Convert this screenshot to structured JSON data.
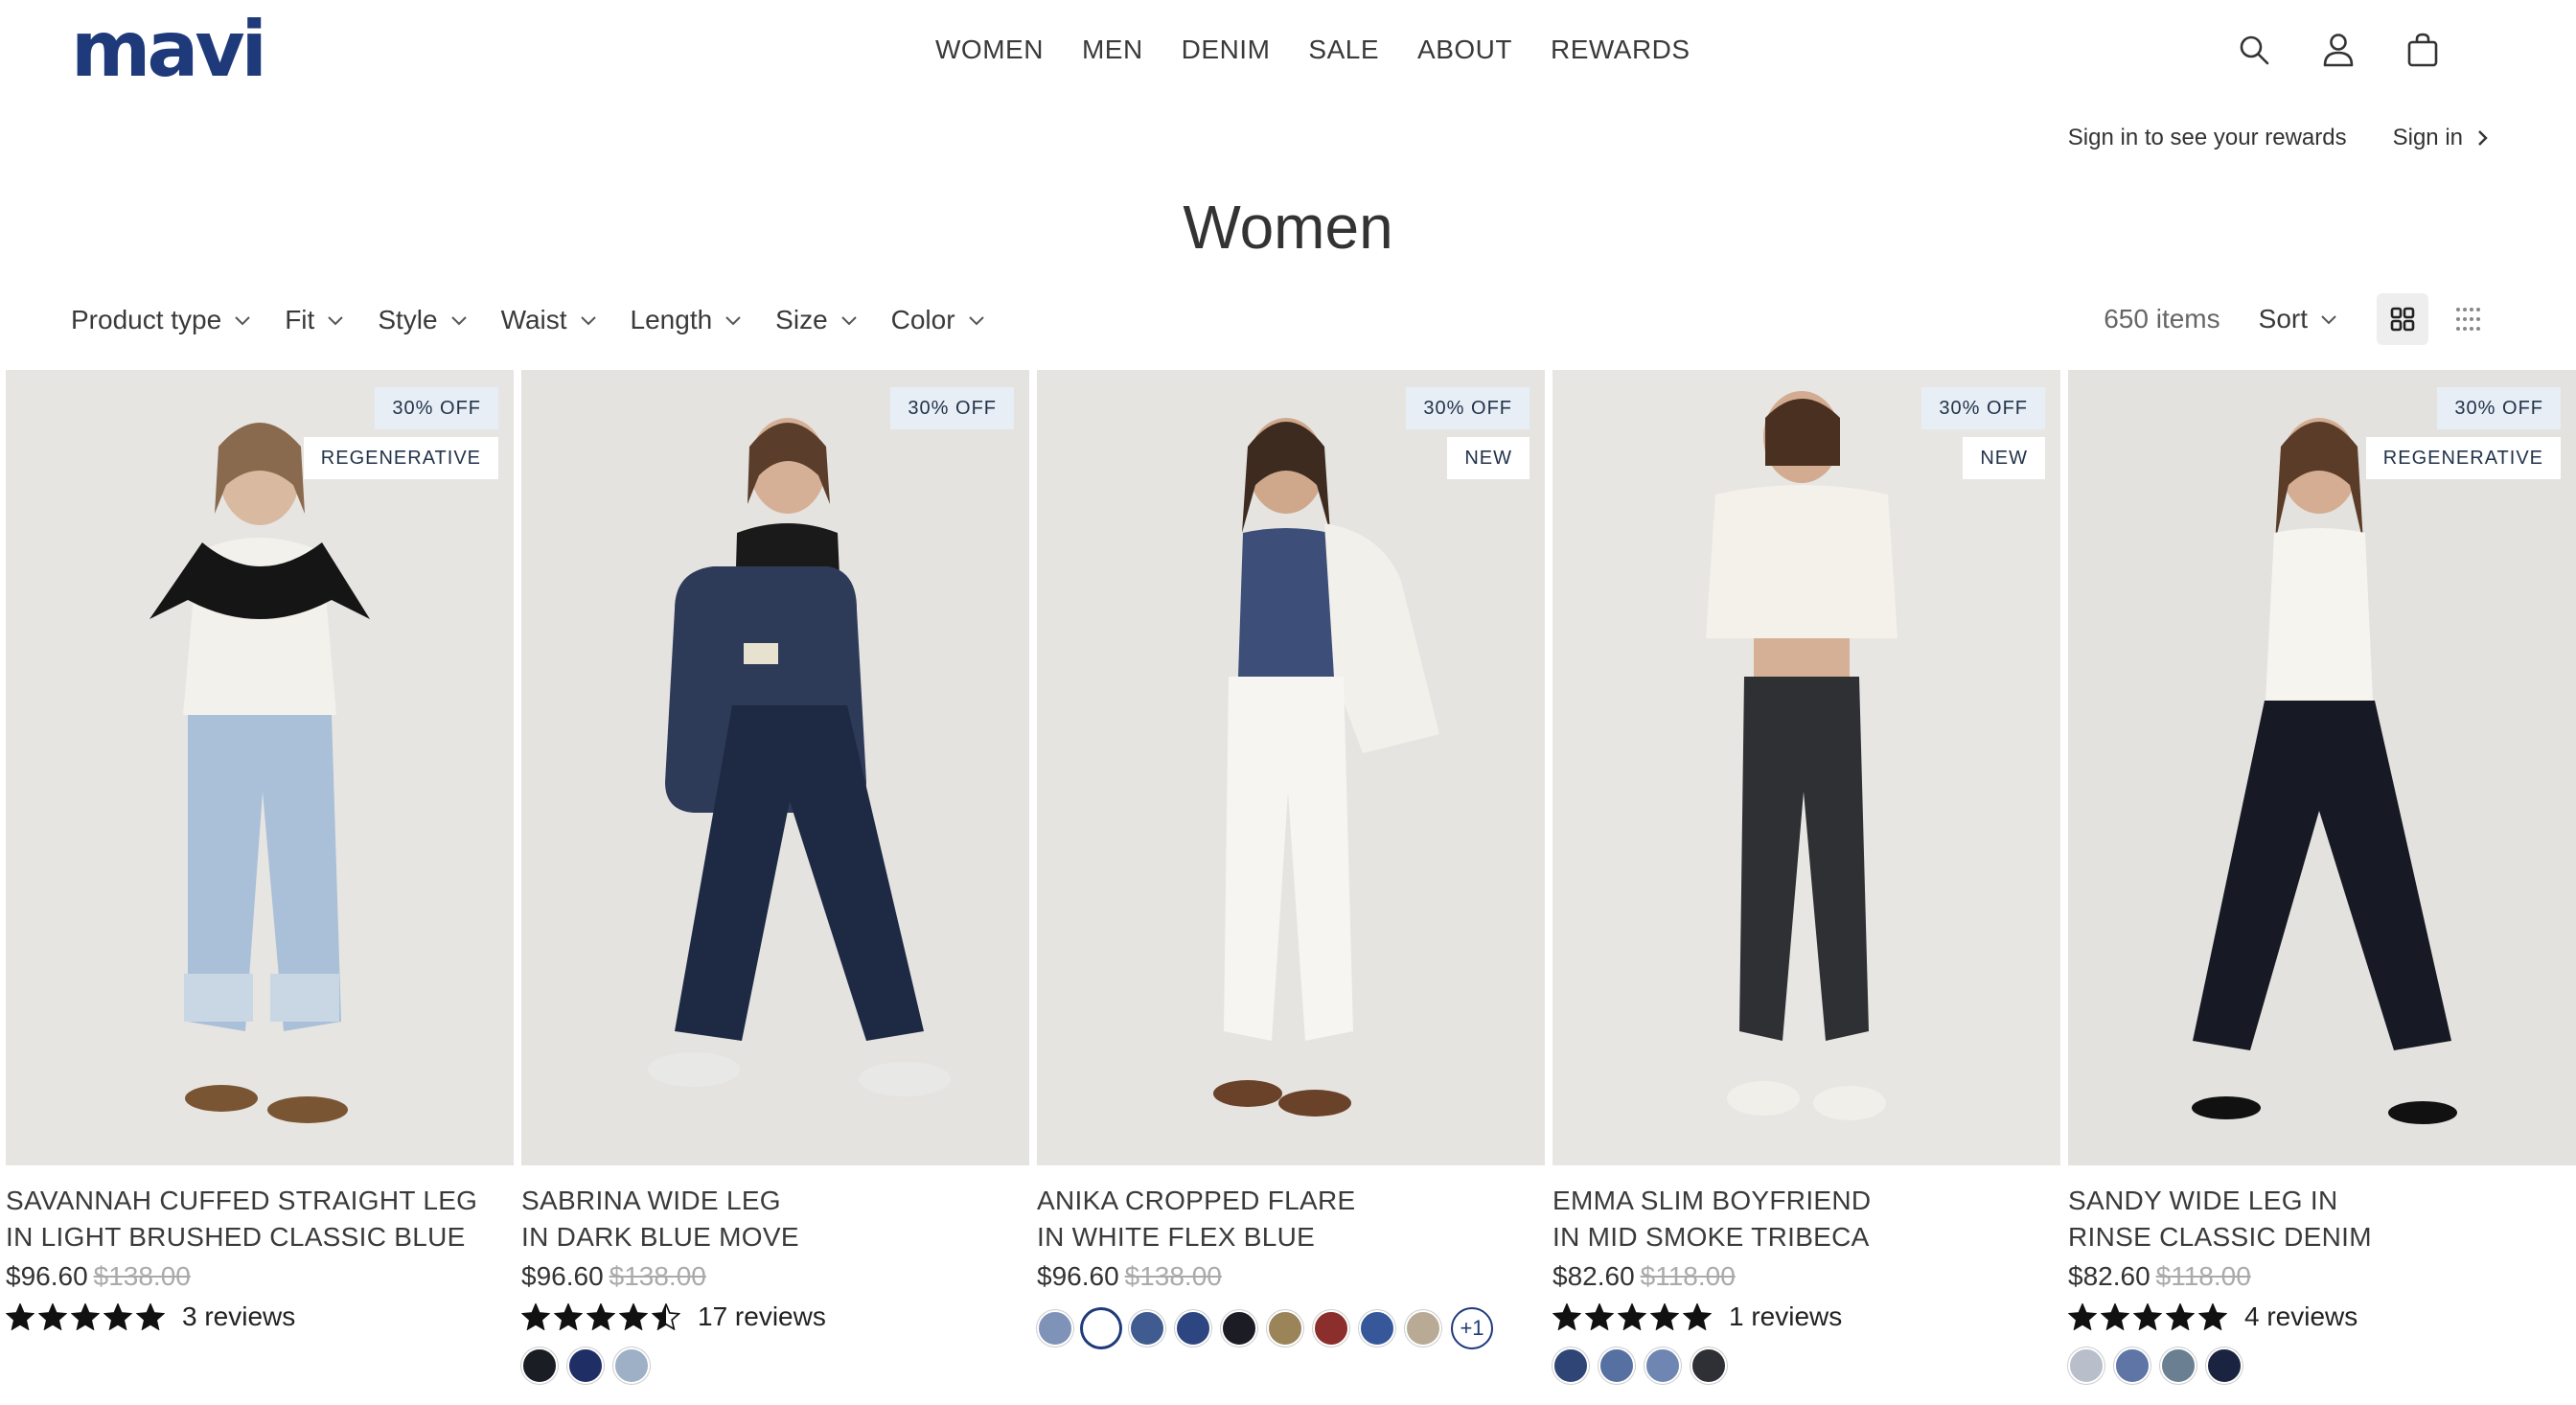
{
  "brand": {
    "logo_text": "mavi",
    "color": "#1f3a7a"
  },
  "nav": {
    "items": [
      "WOMEN",
      "MEN",
      "DENIM",
      "SALE",
      "ABOUT",
      "REWARDS"
    ]
  },
  "header_icons": [
    "search-icon",
    "account-icon",
    "bag-icon"
  ],
  "rewards": {
    "prompt": "Sign in to see your rewards",
    "signin_label": "Sign in"
  },
  "page": {
    "title": "Women"
  },
  "filters": [
    "Product type",
    "Fit",
    "Style",
    "Waist",
    "Length",
    "Size",
    "Color"
  ],
  "results": {
    "count_label": "650 items",
    "sort_label": "Sort"
  },
  "products": [
    {
      "discount": "30% OFF",
      "tag": "REGENERATIVE",
      "name_line1": "SAVANNAH CUFFED STRAIGHT LEG",
      "name_line2": "IN LIGHT BRUSHED CLASSIC BLUE",
      "price": "$96.60",
      "original_price": "$138.00",
      "rating": 5,
      "reviews": "3 reviews",
      "swatches": [],
      "more": ""
    },
    {
      "discount": "30% OFF",
      "tag": "",
      "name_line1": "SABRINA WIDE LEG",
      "name_line2": "IN DARK BLUE MOVE",
      "price": "$96.60",
      "original_price": "$138.00",
      "rating": 4.5,
      "reviews": "17 reviews",
      "swatches": [
        "#1a1d24",
        "#1f2f66",
        "#9eb0c6"
      ],
      "more": ""
    },
    {
      "discount": "30% OFF",
      "tag": "NEW",
      "name_line1": "ANIKA CROPPED FLARE",
      "name_line2": "IN WHITE FLEX BLUE",
      "price": "$96.60",
      "original_price": "$138.00",
      "rating": null,
      "reviews": "",
      "swatches": [
        "#7f93b8",
        "#ffffff",
        "#3f5b8f",
        "#2d4580",
        "#1b1c24",
        "#9a8458",
        "#8c2e2b",
        "#36589b",
        "#b8aa94"
      ],
      "more": "+1"
    },
    {
      "discount": "30% OFF",
      "tag": "NEW",
      "name_line1": "EMMA SLIM BOYFRIEND",
      "name_line2": "IN MID SMOKE TRIBECA",
      "price": "$82.60",
      "original_price": "$118.00",
      "rating": 5,
      "reviews": "1 reviews",
      "swatches": [
        "#2e4576",
        "#5670a2",
        "#6f86b2",
        "#2e3036"
      ],
      "more": ""
    },
    {
      "discount": "30% OFF",
      "tag": "REGENERATIVE",
      "name_line1": "SANDY WIDE LEG IN",
      "name_line2": "RINSE CLASSIC DENIM",
      "price": "$82.60",
      "original_price": "$118.00",
      "rating": 5,
      "reviews": "4 reviews",
      "swatches": [
        "#b8bfca",
        "#5f75a6",
        "#6b7f92",
        "#1a2440"
      ],
      "more": ""
    }
  ]
}
